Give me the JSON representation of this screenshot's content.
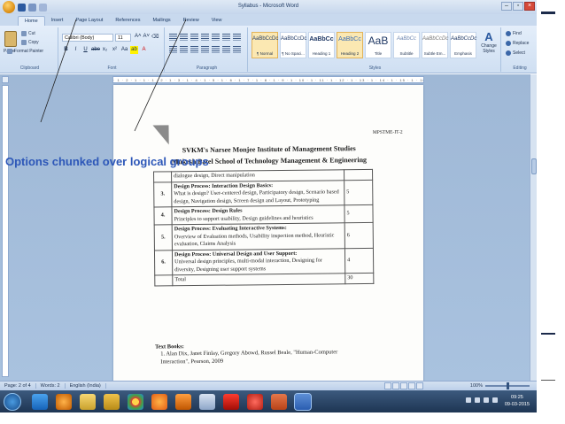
{
  "window": {
    "title": "Syllabus - Microsoft Word"
  },
  "tabs": [
    "Home",
    "Insert",
    "Page Layout",
    "References",
    "Mailings",
    "Review",
    "View"
  ],
  "ribbon": {
    "clipboard": {
      "paste": "Paste",
      "cut": "Cut",
      "copy": "Copy",
      "format_painter": "Format Painter",
      "label": "Clipboard"
    },
    "font": {
      "name": "Calibri (Body)",
      "size": "11",
      "label": "Font"
    },
    "paragraph": {
      "label": "Paragraph"
    },
    "styles": {
      "label": "Styles",
      "items": [
        {
          "sample": "AaBbCcDc",
          "name": "¶ Normal"
        },
        {
          "sample": "AaBbCcDc",
          "name": "¶ No Spaci..."
        },
        {
          "sample": "AaBbCc",
          "name": "Heading 1"
        },
        {
          "sample": "AaBbCc",
          "name": "Heading 2"
        },
        {
          "sample": "AaB",
          "name": "Title"
        },
        {
          "sample": "AaBbCc",
          "name": "Subtitle"
        },
        {
          "sample": "AaBbCcDc",
          "name": "Subtle Em..."
        },
        {
          "sample": "AaBbCcDc",
          "name": "Emphasis"
        }
      ],
      "change_styles": "Change Styles"
    },
    "editing": {
      "label": "Editing",
      "find": "Find",
      "replace": "Replace",
      "select": "Select"
    }
  },
  "document": {
    "code": "MPSTME-IT-2",
    "institute": "SVKM's Narsee Monjee Institute of Management Studies",
    "school": "Mukesh Patel School of Technology Management & Engineering",
    "rows": [
      {
        "num": "",
        "head": "",
        "body": "dialogue design, Direct manipulation",
        "hours": ""
      },
      {
        "num": "3.",
        "head": "Design Process: Interaction Design Basics:",
        "body": "What is design? User-centered design, Participatory design, Scenario based design, Navigation design, Screen design and Layout, Prototyping",
        "hours": "5"
      },
      {
        "num": "4.",
        "head": "Design Process: Design Rules",
        "body": "Principles to support usability, Design guidelines and heuristics",
        "hours": "5"
      },
      {
        "num": "5.",
        "head": "Design Process: Evaluating Interactive Systems:",
        "body": "Overview of Evaluation methods, Usability inspection method, Heuristic evaluation, Claims Analysis",
        "hours": "6"
      },
      {
        "num": "6.",
        "head": "Design Process: Universal Design and User Support:",
        "body": "Universal design principles, multi-modal interaction, Designing for diversity, Designing user support systems",
        "hours": "4"
      },
      {
        "num": "",
        "head": "Total",
        "body": "",
        "hours": "30"
      }
    ],
    "text_books_label": "Text Books:",
    "text_book_1": "1. Alan Dix, Janet Finlay, Gregory Abowd, Russel Beale, \"Human-Computer Interaction\", Pearson, 2009"
  },
  "annotation": "Options chunked over logical groups",
  "status": {
    "page": "Page: 2 of 4",
    "words": "Words: 2",
    "language": "English (India)",
    "zoom": "100%"
  },
  "taskbar": {
    "time": "09:25",
    "date": "09-03-2015"
  }
}
